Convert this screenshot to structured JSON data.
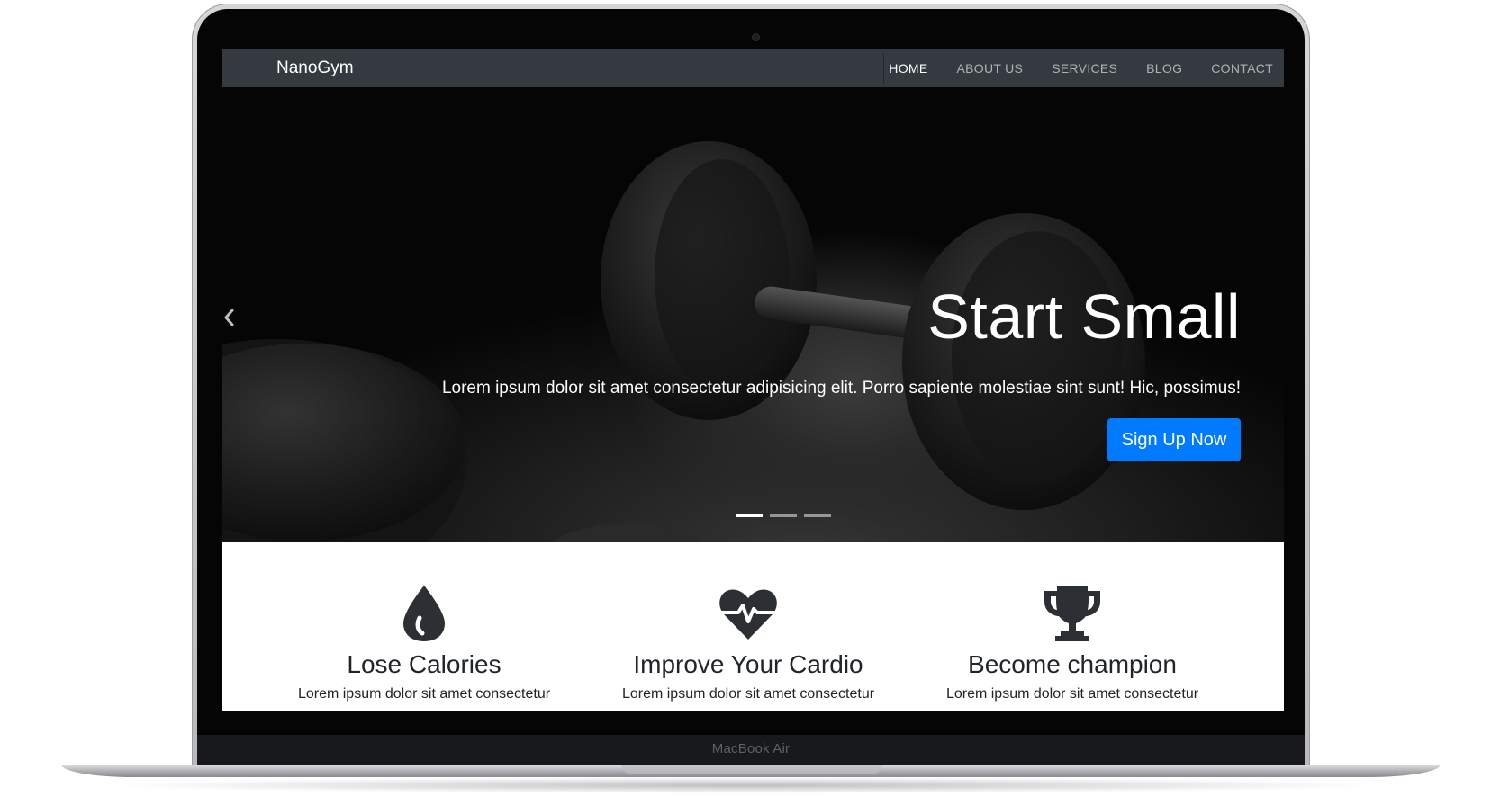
{
  "device": {
    "label": "MacBook Air"
  },
  "navbar": {
    "brand": "NanoGym",
    "links": [
      {
        "label": "HOME",
        "active": true
      },
      {
        "label": "ABOUT US",
        "active": false
      },
      {
        "label": "SERVICES",
        "active": false
      },
      {
        "label": "BLOG",
        "active": false
      },
      {
        "label": "CONTACT",
        "active": false
      }
    ]
  },
  "hero": {
    "prev_icon": "chevron-left-icon",
    "title": "Start Small",
    "subtitle": "Lorem ipsum dolor sit amet consectetur adipisicing elit. Porro sapiente molestiae sint sunt! Hic, possimus!",
    "cta_label": "Sign Up Now",
    "cta_color": "#007bff",
    "slides_total": 3,
    "active_slide": 1
  },
  "features": [
    {
      "icon": "water-drop-icon",
      "title": "Lose Calories",
      "text": "Lorem ipsum dolor sit amet consectetur"
    },
    {
      "icon": "heartbeat-icon",
      "title": "Improve Your Cardio",
      "text": "Lorem ipsum dolor sit amet consectetur"
    },
    {
      "icon": "trophy-icon",
      "title": "Become champion",
      "text": "Lorem ipsum dolor sit amet consectetur"
    }
  ],
  "colors": {
    "navbar_bg": "#343a40",
    "icon_color": "#2c2f33",
    "text_dark": "#212529"
  }
}
